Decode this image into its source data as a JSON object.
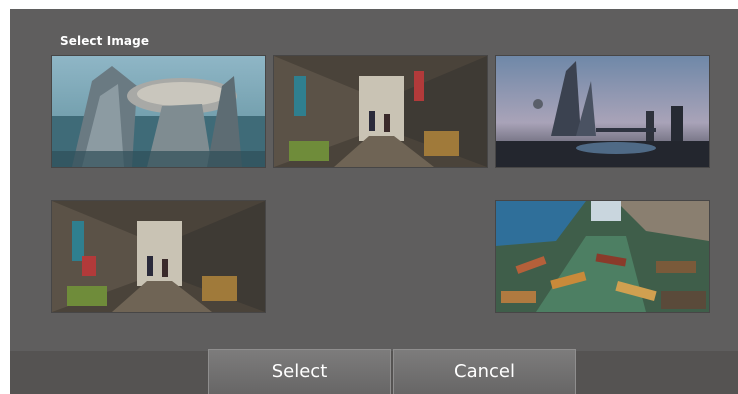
{
  "dialog": {
    "title": "Select Image",
    "select_label": "Select",
    "cancel_label": "Cancel"
  },
  "thumbnails": [
    {
      "subject": "futuristic-sea-city"
    },
    {
      "subject": "market-alley"
    },
    {
      "subject": "sci-fi-skyline"
    },
    {
      "subject": "market-alley"
    },
    {
      "subject": "floating-market"
    }
  ],
  "colors": {
    "dialog_bg": "#5f5e5e",
    "button_bg": "#727171",
    "text": "#ffffff"
  }
}
